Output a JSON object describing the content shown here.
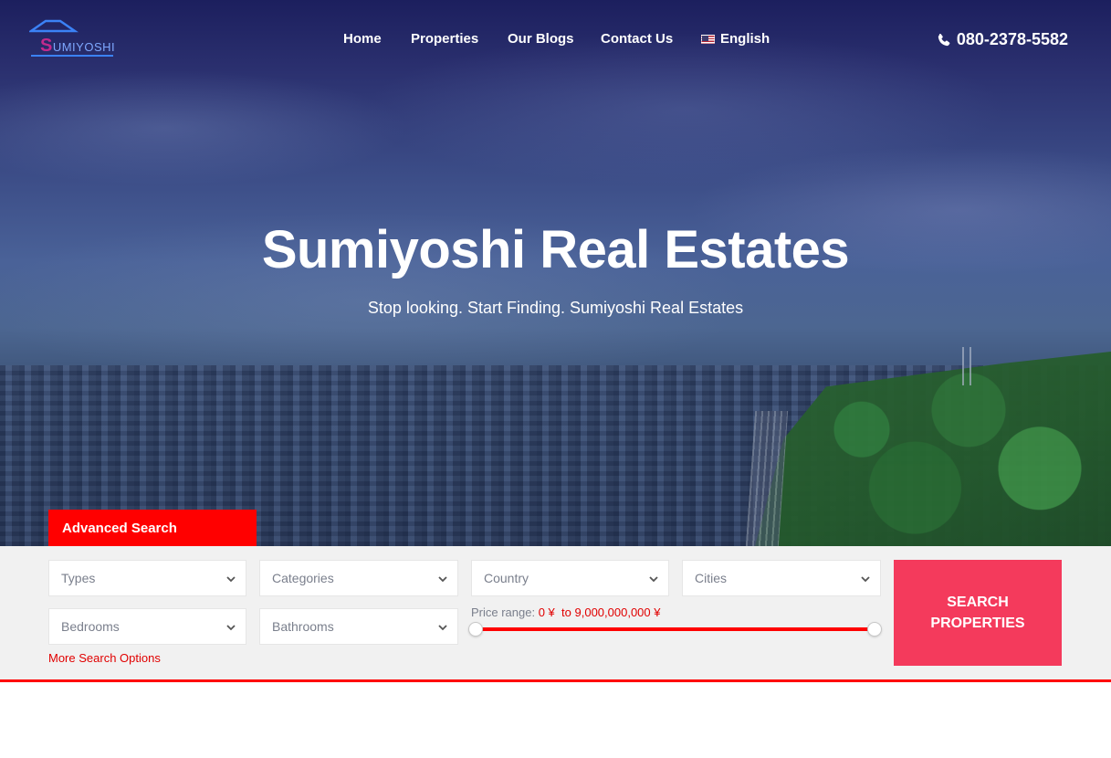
{
  "brand": {
    "logo_initial": "S",
    "logo_rest": "UMIYOSHI",
    "accent_color": "#ff0000",
    "button_color": "#f43a5c"
  },
  "nav": {
    "items": [
      {
        "label": "Home"
      },
      {
        "label": "Properties"
      },
      {
        "label": "Our Blogs"
      },
      {
        "label": "Contact Us"
      }
    ],
    "language": {
      "label": "English",
      "icon": "us-flag-icon"
    },
    "phone": {
      "icon": "phone-icon",
      "number": "080-2378-5582"
    }
  },
  "hero": {
    "title": "Sumiyoshi Real Estates",
    "subtitle": "Stop looking. Start Finding. Sumiyoshi Real Estates"
  },
  "search": {
    "tab_label": "Advanced Search",
    "fields": {
      "types": "Types",
      "categories": "Categories",
      "country": "Country",
      "cities": "Cities",
      "bedrooms": "Bedrooms",
      "bathrooms": "Bathrooms"
    },
    "price": {
      "label": "Price range:",
      "min": "0 ¥",
      "separator": "to",
      "max": "9,000,000,000 ¥",
      "min_fraction": 0,
      "max_fraction": 1
    },
    "more_options": "More Search Options",
    "submit_label": "SEARCH PROPERTIES"
  }
}
